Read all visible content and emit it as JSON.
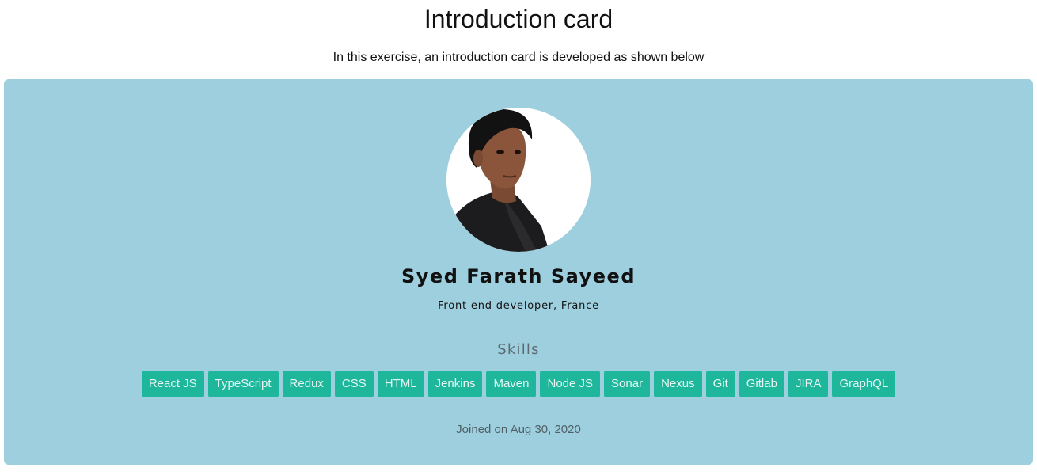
{
  "page": {
    "title": "Introduction card",
    "subtitle": "In this exercise, an introduction card is developed as shown below"
  },
  "card": {
    "background": "#9ecfdf",
    "name": "Syed Farath Sayeed",
    "role": "Front end developer, France",
    "skills_heading": "Skills",
    "skills": [
      "React JS",
      "TypeScript",
      "Redux",
      "CSS",
      "HTML",
      "Jenkins",
      "Maven",
      "Node JS",
      "Sonar",
      "Nexus",
      "Git",
      "Gitlab",
      "JIRA",
      "GraphQL"
    ],
    "skill_chip_color": "#1fb79c",
    "joined": "Joined on Aug 30, 2020"
  }
}
